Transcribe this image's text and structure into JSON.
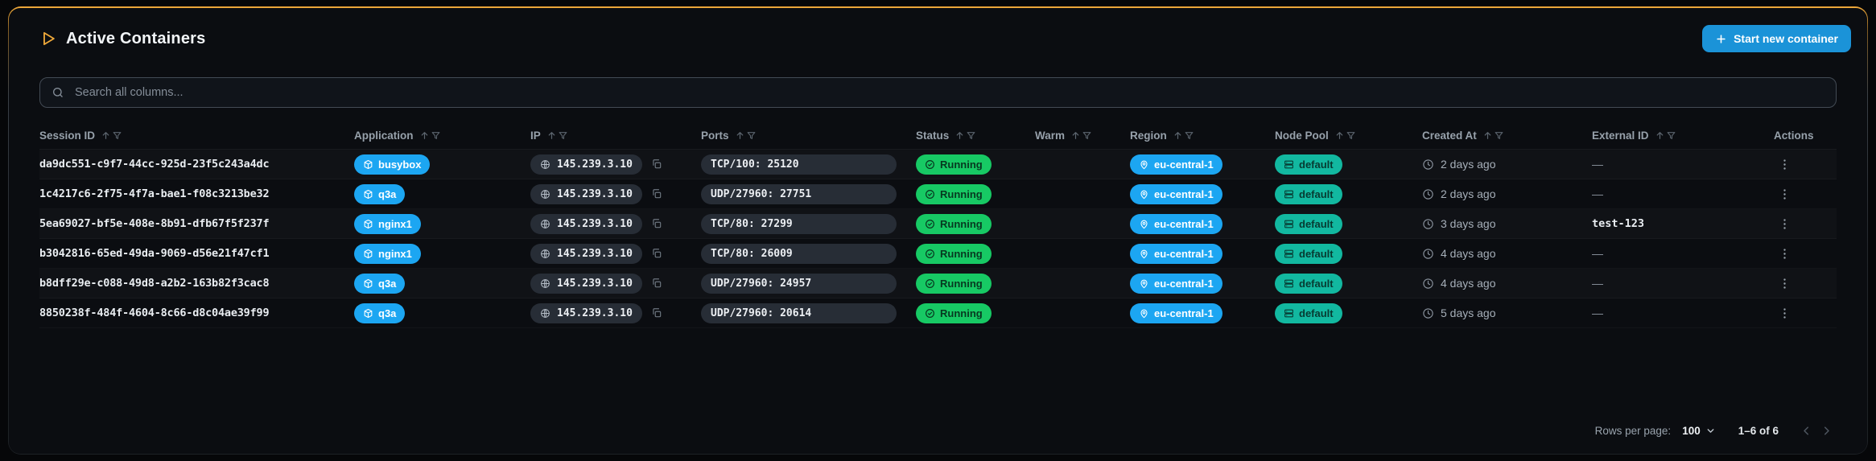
{
  "header": {
    "title": "Active Containers",
    "start_button_label": "Start new container"
  },
  "search": {
    "placeholder": "Search all columns..."
  },
  "table": {
    "columns": [
      "Session ID",
      "Application",
      "IP",
      "Ports",
      "Status",
      "Warm",
      "Region",
      "Node Pool",
      "Created At",
      "External ID",
      "Actions"
    ],
    "empty_placeholder": "—",
    "rows": [
      {
        "session_id": "da9dc551-c9f7-44cc-925d-23f5c243a4dc",
        "application": "busybox",
        "ip": "145.239.3.10",
        "ports": "TCP/100: 25120",
        "status": "Running",
        "warm": "",
        "region": "eu-central-1",
        "node_pool": "default",
        "created_at": "2 days ago",
        "external_id": "—"
      },
      {
        "session_id": "1c4217c6-2f75-4f7a-bae1-f08c3213be32",
        "application": "q3a",
        "ip": "145.239.3.10",
        "ports": "UDP/27960: 27751",
        "status": "Running",
        "warm": "",
        "region": "eu-central-1",
        "node_pool": "default",
        "created_at": "2 days ago",
        "external_id": "—"
      },
      {
        "session_id": "5ea69027-bf5e-408e-8b91-dfb67f5f237f",
        "application": "nginx1",
        "ip": "145.239.3.10",
        "ports": "TCP/80: 27299",
        "status": "Running",
        "warm": "",
        "region": "eu-central-1",
        "node_pool": "default",
        "created_at": "3 days ago",
        "external_id": "test-123"
      },
      {
        "session_id": "b3042816-65ed-49da-9069-d56e21f47cf1",
        "application": "nginx1",
        "ip": "145.239.3.10",
        "ports": "TCP/80: 26009",
        "status": "Running",
        "warm": "",
        "region": "eu-central-1",
        "node_pool": "default",
        "created_at": "4 days ago",
        "external_id": "—"
      },
      {
        "session_id": "b8dff29e-c088-49d8-a2b2-163b82f3cac8",
        "application": "q3a",
        "ip": "145.239.3.10",
        "ports": "UDP/27960: 24957",
        "status": "Running",
        "warm": "",
        "region": "eu-central-1",
        "node_pool": "default",
        "created_at": "4 days ago",
        "external_id": "—"
      },
      {
        "session_id": "8850238f-484f-4604-8c66-d8c04ae39f99",
        "application": "q3a",
        "ip": "145.239.3.10",
        "ports": "UDP/27960: 20614",
        "status": "Running",
        "warm": "",
        "region": "eu-central-1",
        "node_pool": "default",
        "created_at": "5 days ago",
        "external_id": "—"
      }
    ]
  },
  "footer": {
    "rows_per_page_label": "Rows per page:",
    "rows_per_page_value": "100",
    "range": "1–6 of 6"
  },
  "colors": {
    "accent_yellow": "#f0a93a",
    "button_blue": "#1b93d8",
    "chip_blue": "#1ca6f2",
    "chip_green": "#17c964",
    "chip_teal": "#12b8a0"
  }
}
